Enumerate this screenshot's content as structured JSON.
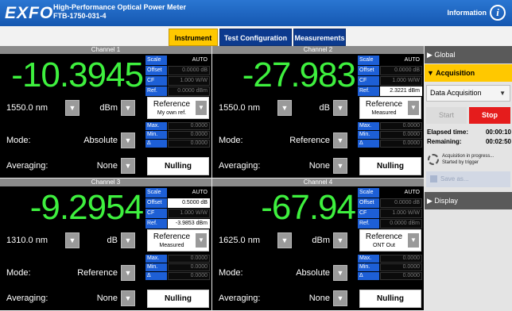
{
  "header": {
    "brand": "EXFO",
    "title": "High-Performance Optical Power Meter",
    "model": "FTB-1750-031-4",
    "info_label": "Information",
    "info_icon": "info-circle-icon"
  },
  "tabs": [
    {
      "label": "Instrument",
      "active": true
    },
    {
      "label": "Test Configuration",
      "active": false
    },
    {
      "label": "Measurements",
      "active": false
    }
  ],
  "labels": {
    "scale": "Scale",
    "offset": "Offset",
    "cf": "CF",
    "ref": "Ref.",
    "max": "Max.",
    "min": "Min.",
    "delta": "Δ",
    "mode": "Mode:",
    "averaging": "Averaging:",
    "dropdown_arrow": "▼"
  },
  "channels": [
    {
      "title": "Channel 1",
      "reading": "-10.3945",
      "scale": "AUTO",
      "offset": "0.0000 dB",
      "cf": "1.000 W/W",
      "ref": "0.0000 dBm",
      "highlight": [],
      "wavelength": "1550.0 nm",
      "unit": "dBm",
      "ref_button": {
        "label": "Reference",
        "sub": "My own ref."
      },
      "max": "0.0000",
      "min": "0.0000",
      "delta": "0.0000",
      "mode": "Absolute",
      "averaging": "None",
      "nulling": "Nulling"
    },
    {
      "title": "Channel 2",
      "reading": "-27.983",
      "scale": "AUTO",
      "offset": "0.0000 dB",
      "cf": "1.000 W/W",
      "ref": "2.3221 dBm",
      "highlight": [
        "ref"
      ],
      "wavelength": "1550.0 nm",
      "unit": "dB",
      "ref_button": {
        "label": "Reference",
        "sub": "Measured"
      },
      "max": "0.0000",
      "min": "0.0000",
      "delta": "0.0000",
      "mode": "Reference",
      "averaging": "None",
      "nulling": "Nulling"
    },
    {
      "title": "Channel 3",
      "reading": "-9.2954",
      "scale": "AUTO",
      "offset": "0.5000 dB",
      "cf": "1.000 W/W",
      "ref": "-3.9853 dBm",
      "highlight": [
        "offset",
        "ref"
      ],
      "wavelength": "1310.0 nm",
      "unit": "dB",
      "ref_button": {
        "label": "Reference",
        "sub": "Measured"
      },
      "max": "0.0000",
      "min": "0.0000",
      "delta": "0.0000",
      "mode": "Reference",
      "averaging": "None",
      "nulling": "Nulling"
    },
    {
      "title": "Channel 4",
      "reading": "-67.94",
      "scale": "AUTO",
      "offset": "0.0000 dB",
      "cf": "1.000 W/W",
      "ref": "0.0000 dBm",
      "highlight": [],
      "wavelength": "1625.0 nm",
      "unit": "dBm",
      "ref_button": {
        "label": "Reference",
        "sub": "ONT Out"
      },
      "max": "0.0000",
      "min": "0.0000",
      "delta": "0.0000",
      "mode": "Absolute",
      "averaging": "None",
      "nulling": "Nulling"
    }
  ],
  "sidebar": {
    "global": "▶ Global",
    "acquisition": "▼ Acquisition",
    "data_acquisition": "Data Acquisition",
    "start": "Start",
    "stop": "Stop",
    "elapsed_label": "Elapsed time:",
    "elapsed": "00:00:10",
    "remaining_label": "Remaining:",
    "remaining": "00:02:50",
    "status_line1": "Acquisition in progress...",
    "status_line2": "Started by trigger",
    "save_as": "Save as...",
    "display": "▶ Display"
  },
  "colors": {
    "header_blue": "#1f6ac6",
    "tab_active": "#ffc800",
    "tab_inactive": "#0c3a8e",
    "reading_green": "#3ef03e",
    "label_blue": "#1d5fd6",
    "stop_red": "#e51c1c"
  }
}
